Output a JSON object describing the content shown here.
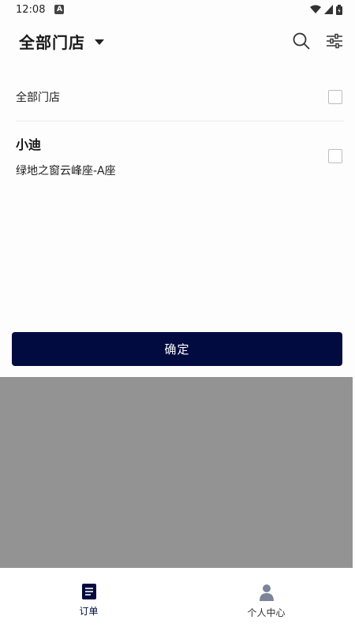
{
  "status_bar": {
    "time": "12:08",
    "notification_icon": "A"
  },
  "header": {
    "title": "全部门店",
    "icons": [
      "chevron-down-icon",
      "search-icon",
      "filter-sliders-icon"
    ]
  },
  "store_list": {
    "all_option_label": "全部门店",
    "stores": [
      {
        "name": "小迪",
        "address": "绿地之窗云峰座-A座"
      }
    ]
  },
  "confirm_label": "确定",
  "bottom_nav": {
    "items": [
      {
        "label": "订单",
        "icon": "orders-icon",
        "active": true
      },
      {
        "label": "个人中心",
        "icon": "person-icon",
        "active": false
      }
    ]
  },
  "colors": {
    "accent": "#020b40",
    "overlay": "#939393",
    "divider": "#ececec"
  }
}
